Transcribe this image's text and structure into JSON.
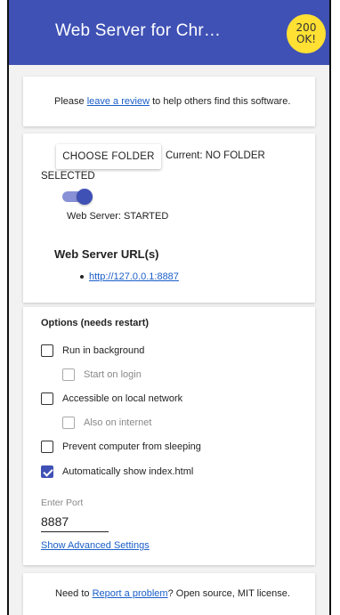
{
  "header": {
    "title": "Web Server for Chr…",
    "badge_line1": "200",
    "badge_line2": "OK!",
    "color": "#3f51b5",
    "badge_color": "#ffe033"
  },
  "review": {
    "prefix": "Please ",
    "link": "leave a review",
    "suffix": " to help others find this software."
  },
  "server": {
    "choose_folder_label": "CHOOSE FOLDER",
    "current_label": "Current: NO FOLDER",
    "current_label_cont": "SELECTED",
    "toggle_on": true,
    "status": "Web Server: STARTED",
    "urls_title": "Web Server URL(s)",
    "urls": [
      "http://127.0.0.1:8887"
    ]
  },
  "options": {
    "title": "Options (needs restart)",
    "items": [
      {
        "label": "Run in background",
        "checked": false,
        "disabled": false
      },
      {
        "label": "Start on login",
        "checked": false,
        "disabled": true
      },
      {
        "label": "Accessible on local network",
        "checked": false,
        "disabled": false
      },
      {
        "label": "Also on internet",
        "checked": false,
        "disabled": true
      },
      {
        "label": "Prevent computer from sleeping",
        "checked": false,
        "disabled": false
      },
      {
        "label": "Automatically show index.html",
        "checked": true,
        "disabled": false
      }
    ],
    "port_label": "Enter Port",
    "port_value": "8887",
    "advanced_link": "Show Advanced Settings"
  },
  "footer": {
    "prefix": "Need to ",
    "link": "Report a problem",
    "suffix": "? Open source, MIT license."
  }
}
